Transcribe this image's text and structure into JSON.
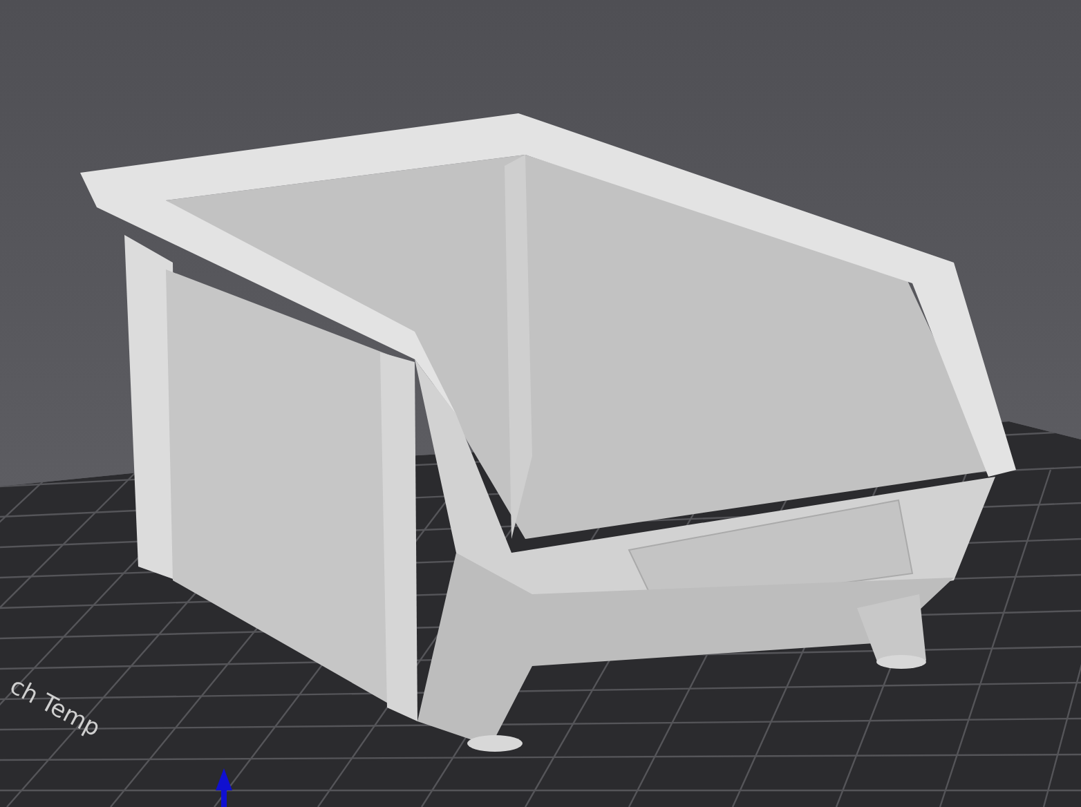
{
  "viewport": {
    "bed_label": "ch Temp"
  }
}
